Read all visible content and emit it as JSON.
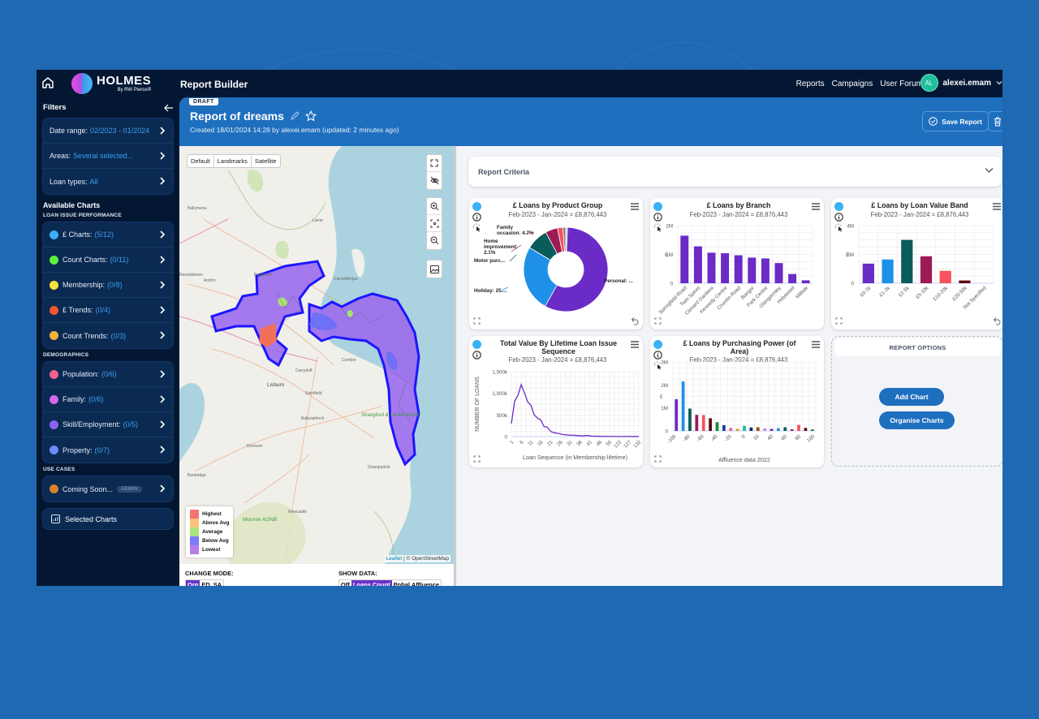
{
  "topbar": {
    "logo_main": "HOLMES",
    "logo_sub": "By RW Pierce®",
    "app_title": "Report Builder",
    "nav": [
      "Reports",
      "Campaigns",
      "User Forum"
    ],
    "user_initials": "AL",
    "username": "alexei.emam"
  },
  "sidebar": {
    "filters_title": "Filters",
    "filters": [
      {
        "label": "Date range:",
        "value": "02/2023 - 01/2024"
      },
      {
        "label": "Areas:",
        "value": "Several selected..."
      },
      {
        "label": "Loan types:",
        "value": "All"
      }
    ],
    "available_title": "Available Charts",
    "sections": [
      {
        "title": "LOAN ISSUE PERFORMANCE",
        "items": [
          {
            "label": "£ Charts:",
            "value": "(5/12)",
            "color": "#3ab0f5"
          },
          {
            "label": "Count Charts:",
            "value": "(0/11)",
            "color": "#5ef03c"
          },
          {
            "label": "Membership:",
            "value": "(0/8)",
            "color": "#f7e23c"
          },
          {
            "label": "£ Trends:",
            "value": "(0/4)",
            "color": "#f2582c"
          },
          {
            "label": "Count Trends:",
            "value": "(0/3)",
            "color": "#f6b03c"
          }
        ]
      },
      {
        "title": "DEMOGRAPHICS",
        "items": [
          {
            "label": "Population:",
            "value": "(0/6)",
            "color": "#f0608e"
          },
          {
            "label": "Family:",
            "value": "(0/6)",
            "color": "#d865ee"
          },
          {
            "label": "Skill/Employment:",
            "value": "(0/5)",
            "color": "#8a62f0"
          },
          {
            "label": "Property:",
            "value": "(0/7)",
            "color": "#6a8cf8"
          }
        ]
      },
      {
        "title": "USE CASES",
        "items": [
          {
            "label": "Coming Soon...",
            "value": "",
            "badge": "ADMIN",
            "color": "#d9822b"
          }
        ]
      }
    ],
    "selected_charts": "Selected Charts"
  },
  "report": {
    "status": "DRAFT",
    "title": "Report of dreams",
    "meta": "Created 18/01/2024 14:28 by alexei.emam (updated: 2 minutes ago)",
    "save_label": "Save Report"
  },
  "map": {
    "tile_modes": [
      "Default",
      "Landmarks",
      "Satellite"
    ],
    "place_labels": [
      "Ballymena",
      "Larne",
      "Ballyclare",
      "Antrim",
      "Randalstown",
      "Carrickfergus",
      "Lisburn",
      "Carryduff",
      "Comber",
      "Saintfield",
      "Ballynahinch",
      "Dromore",
      "Banbridge",
      "Newcastle",
      "Downpatrick",
      "Mourne AONB",
      "Strangford & Lecale AONB"
    ],
    "legend": [
      {
        "label": "Highest",
        "color": "#f47373"
      },
      {
        "label": "Above Avg",
        "color": "#fbc27a"
      },
      {
        "label": "Average",
        "color": "#a9e47b"
      },
      {
        "label": "Below Avg",
        "color": "#7b7cf8"
      },
      {
        "label": "Lowest",
        "color": "#b87be8"
      }
    ],
    "attribution_leaflet": "Leaflet",
    "attribution_osm": "| © OpenStreetMap",
    "change_mode_label": "CHANGE MODE:",
    "modes": [
      "Org",
      "ED",
      "SA"
    ],
    "active_mode": "Org",
    "show_data_label": "SHOW DATA:",
    "data_options": [
      "Off",
      "Loans Count",
      "Pobal Affluence"
    ],
    "active_data": "Loans Count"
  },
  "criteria": {
    "label": "Report Criteria"
  },
  "options": {
    "title": "REPORT OPTIONS",
    "add_chart": "Add Chart",
    "organise_charts": "Organise Charts"
  },
  "chart_data": [
    {
      "type": "pie",
      "title": "£ Loans by Product Group",
      "subtitle": "Feb-2023 - Jan-2024 = £8,876,443",
      "donut": true,
      "slices": [
        {
          "label": "Personal: ...",
          "value": 57.5,
          "color": "#6a2bc7"
        },
        {
          "label": "Holiday: 25....",
          "value": 25.5,
          "color": "#1f90e8"
        },
        {
          "label": "Motor purc...",
          "value": 8.5,
          "color": "#0a5c5a"
        },
        {
          "label": "Home improvement: 2.1%",
          "value": 4.7,
          "color": "#9c1a55"
        },
        {
          "label": "Family occasion: 4.7%",
          "value": 2.1,
          "color": "#f7525e"
        },
        {
          "label": "",
          "value": 1.0,
          "color": "#7a7a7a"
        },
        {
          "label": "",
          "value": 0.7,
          "color": "#c8c8c8"
        }
      ]
    },
    {
      "type": "bar",
      "title": "£ Loans by Branch",
      "subtitle": "Feb-2023 - Jan-2024 = £8,876,443",
      "ylabel": "£",
      "ylim": [
        0,
        2000000
      ],
      "yticks": [
        "0",
        "1M",
        "2M"
      ],
      "categories": [
        "Springfield Road",
        "Twin Spires",
        "Clonard Gardens",
        "Kennedy Centre",
        "Crumlin Road",
        "Bangor",
        "Park Centre",
        "Glengormley",
        "Holywood",
        "Millisle"
      ],
      "values": [
        1650000,
        1280000,
        1060000,
        1040000,
        970000,
        890000,
        860000,
        700000,
        320000,
        100000
      ],
      "colors": [
        "#6a2bc7"
      ]
    },
    {
      "type": "bar",
      "title": "£ Loans by Loan Value Band",
      "subtitle": "Feb-2023 - Jan-2024 = £8,876,443",
      "ylabel": "£",
      "ylim": [
        0,
        4000000
      ],
      "yticks": [
        "0",
        "2M",
        "4M"
      ],
      "categories": [
        "£0-1k",
        "£1-2k",
        "£2-5k",
        "£5-10k",
        "£10-20k",
        "£20-50k",
        "Not Specified"
      ],
      "values": [
        1360000,
        1650000,
        3010000,
        1870000,
        860000,
        190000,
        0
      ],
      "colors": [
        "#6a2bc7",
        "#1f90e8",
        "#0a5c5a",
        "#9c1a55",
        "#f7525e",
        "#5c0a16",
        "#999999"
      ]
    },
    {
      "type": "line",
      "title": "Total Value By Lifetime Loan Issue Sequence",
      "subtitle": "Feb-2023 - Jan-2024 = £8,876,443",
      "xlabel": "Loan Sequence (in Membership lifetime)",
      "ylabel": "NUMBER OF LOANS",
      "ylim": [
        0,
        1500000
      ],
      "yticks": [
        "0",
        "500k",
        "1,000k",
        "1,500k"
      ],
      "xticks": [
        "1",
        "6",
        "11",
        "16",
        "21",
        "26",
        "31",
        "36",
        "41",
        "46",
        "55",
        "122",
        "127",
        "132"
      ],
      "values": [
        300000,
        820000,
        950000,
        1200000,
        1010000,
        800000,
        720000,
        500000,
        430000,
        380000,
        230000,
        220000,
        120000,
        90000,
        80000,
        60000,
        45000,
        40000,
        30000,
        30000,
        25000,
        20000,
        15000,
        28000,
        15000,
        10000,
        8000,
        6000,
        5000,
        5000,
        4000,
        4000,
        3000,
        3000,
        2000,
        2000,
        2000,
        1000,
        1000,
        1000
      ],
      "color": "#6a2bc7"
    },
    {
      "type": "bar",
      "title": "£ Loans by Purchasing Power (of Area)",
      "subtitle": "Feb-2023 - Jan-2024 = £8,876,443",
      "xlabel": "Affluence data 2022",
      "ylabel": "£",
      "ylim": [
        0,
        3000000
      ],
      "yticks": [
        "0",
        "1M",
        "2M",
        "3M"
      ],
      "xticks": [
        "-100",
        "-80",
        "-60",
        "-40",
        "-20",
        "0",
        "20",
        "40",
        "60",
        "80",
        "100"
      ],
      "values": [
        1380000,
        2150000,
        970000,
        700000,
        690000,
        550000,
        380000,
        250000,
        130000,
        90000,
        220000,
        150000,
        160000,
        110000,
        90000,
        120000,
        160000,
        70000,
        260000,
        130000,
        70000
      ],
      "colors": [
        "#6a2bc7",
        "#1f90e8",
        "#0a5c5a",
        "#9c1a55",
        "#f7525e",
        "#5c0a16",
        "#1b8a3a",
        "#1a3ea0",
        "#f05fa0",
        "#d99a1e",
        "#26b5a5",
        "#0c2e55",
        "#9a4a10",
        "#b38af0",
        "#6a2bc7",
        "#1f90e8",
        "#0a5c5a",
        "#9c1a55",
        "#f7525e",
        "#5c0a16",
        "#1b8a3a"
      ]
    }
  ]
}
